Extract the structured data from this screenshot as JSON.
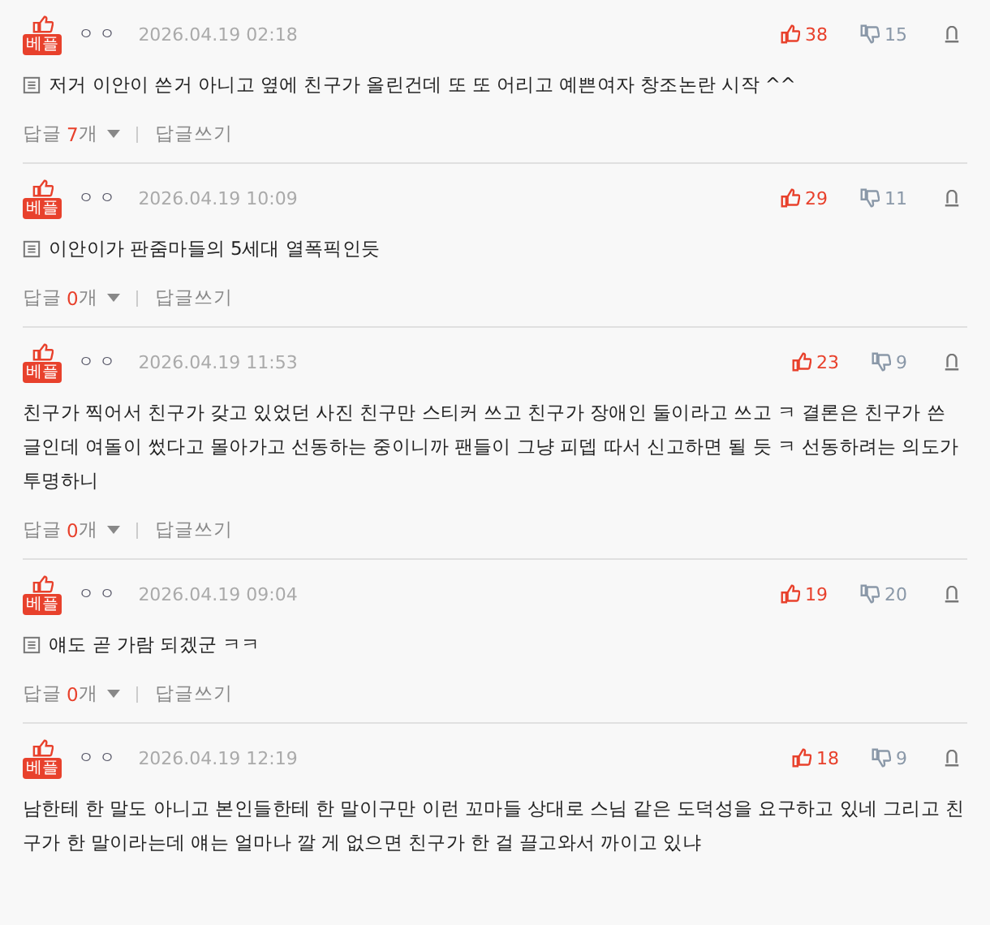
{
  "comments": [
    {
      "badge": "베플",
      "author": "ㅇ ㅇ",
      "date": "2026.04.19 02:18",
      "likes": "38",
      "dislikes": "15",
      "memo": true,
      "text": "저거 이안이 쓴거 아니고 옆에 친구가 올린건데 또 또 어리고 예쁜여자 창조논란 시작 ^^",
      "reply": {
        "label": "답글",
        "count": "7",
        "unit": "개",
        "write": "답글쓰기"
      }
    },
    {
      "badge": "베플",
      "author": "ㅇ ㅇ",
      "date": "2026.04.19 10:09",
      "likes": "29",
      "dislikes": "11",
      "memo": true,
      "text": "이안이가 판줌마들의 5세대 열폭픽인듯",
      "reply": {
        "label": "답글",
        "count": "0",
        "unit": "개",
        "write": "답글쓰기"
      }
    },
    {
      "badge": "베플",
      "author": "ㅇ ㅇ",
      "date": "2026.04.19 11:53",
      "likes": "23",
      "dislikes": "9",
      "memo": false,
      "text": "친구가 찍어서 친구가 갖고 있었던 사진 친구만 스티커 쓰고 친구가 장애인 둘이라고 쓰고 ㅋ 결론은 친구가 쓴 글인데 여돌이 썼다고 몰아가고 선동하는 중이니까 팬들이 그냥 피뎁 따서 신고하면 될 듯 ㅋ 선동하려는 의도가 투명하니",
      "reply": {
        "label": "답글",
        "count": "0",
        "unit": "개",
        "write": "답글쓰기"
      }
    },
    {
      "badge": "베플",
      "author": "ㅇ ㅇ",
      "date": "2026.04.19 09:04",
      "likes": "19",
      "dislikes": "20",
      "memo": true,
      "text": "얘도 곧 가람 되겠군 ㅋㅋ",
      "reply": {
        "label": "답글",
        "count": "0",
        "unit": "개",
        "write": "답글쓰기"
      }
    },
    {
      "badge": "베플",
      "author": "ㅇ ㅇ",
      "date": "2026.04.19 12:19",
      "likes": "18",
      "dislikes": "9",
      "memo": false,
      "text": "남한테 한 말도 아니고 본인들한테 한 말이구만 이런 꼬마들 상대로 스님 같은 도덕성을 요구하고 있네 그리고 친구가 한 말이라는데 얘는 얼마나 깔 게 없으면 친구가 한 걸 끌고와서 까이고 있냐"
    }
  ]
}
